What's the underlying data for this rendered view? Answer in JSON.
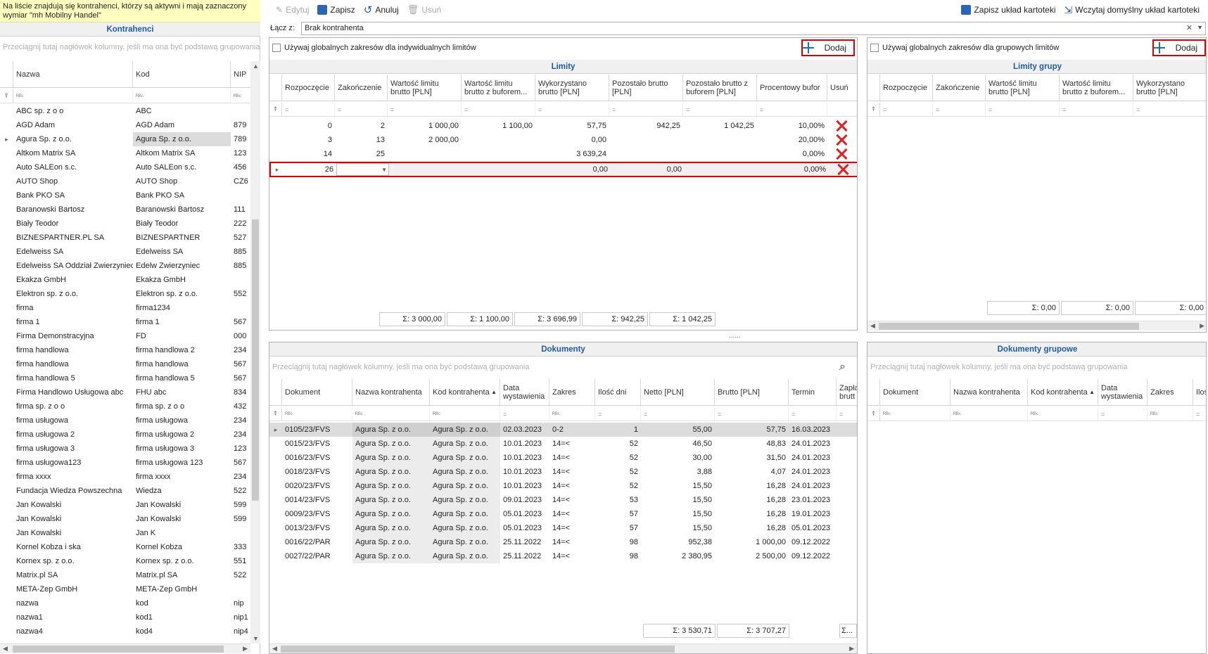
{
  "info_text": "Na liście znajdują się kontrahenci, którzy są aktywni i mają zaznaczony wymiar \"mh Mobilny Handel\"",
  "left": {
    "title": "Kontrahenci",
    "group_hint": "Przeciągnij tutaj nagłówek kolumny, jeśli ma ona być podstawą grupowania",
    "columns": [
      "Nazwa",
      "Kod",
      "NIP"
    ],
    "filter_glyph": "ᴿᴮᶜ",
    "rows": [
      [
        "ABC sp. z o o",
        "ABC",
        ""
      ],
      [
        "AGD Adam",
        "AGD Adam",
        "879"
      ],
      [
        "Agura Sp. z o.o.",
        "Agura Sp. z o.o.",
        "789"
      ],
      [
        "Altkom Matrix SA",
        "Altkom Matrix SA",
        "123"
      ],
      [
        "Auto SALEon s.c.",
        "Auto SALEon s.c.",
        "456"
      ],
      [
        "AUTO Shop",
        "AUTO Shop",
        "CZ6"
      ],
      [
        "Bank PKO SA",
        "Bank PKO SA",
        ""
      ],
      [
        "Baranowski Bartosz",
        "Baranowski Bartosz",
        "111"
      ],
      [
        "Biały Teodor",
        "Biały Teodor",
        "222"
      ],
      [
        "BIZNESPARTNER.PL SA",
        "BIZNESPARTNER",
        "527"
      ],
      [
        "Edelweiss SA",
        "Edelweiss SA",
        "885"
      ],
      [
        "Edelweiss SA Oddział Zwierzyniec",
        "Edelw Zwierzyniec",
        "885"
      ],
      [
        "Ekakza GmbH",
        "Ekakza GmbH",
        ""
      ],
      [
        "Elektron sp. z o.o.",
        "Elektron sp. z o.o.",
        "552"
      ],
      [
        "firma",
        "firma1234",
        ""
      ],
      [
        "firma 1",
        "firma 1",
        "567"
      ],
      [
        "Firma Demonstracyjna",
        "FD",
        "000"
      ],
      [
        "firma handlowa",
        "firma handlowa 2",
        "234"
      ],
      [
        "firma handlowa",
        "firma handlowa",
        "567"
      ],
      [
        "firma handlowa 5",
        "firma handlowa 5",
        "567"
      ],
      [
        "Firma Handlowo Usługowa abc",
        "FHU abc",
        "834"
      ],
      [
        "firma sp. z o o",
        "firma sp. z o o",
        "432"
      ],
      [
        "firma usługowa",
        "firma usługowa",
        "234"
      ],
      [
        "firma usługowa 2",
        "firma usługowa 2",
        "234"
      ],
      [
        "firma usługowa 3",
        "firma usługowa 3",
        "123"
      ],
      [
        "firma usługowa123",
        "firma usługowa 123",
        "567"
      ],
      [
        "firma xxxx",
        "firma xxxx",
        "234"
      ],
      [
        "Fundacja Wiedza Powszechna",
        "Wiedza",
        "522"
      ],
      [
        "Jan Kowalski",
        "Jan Kowalski",
        "599"
      ],
      [
        "Jan Kowalski",
        "Jan Kowalski",
        "599"
      ],
      [
        "Jan Kowalski",
        "Jan K",
        ""
      ],
      [
        "Kornel Kobza i ska",
        "Kornel Kobza",
        "333"
      ],
      [
        "Kornex sp. z o.o.",
        "Kornex sp. z o.o.",
        "551"
      ],
      [
        "Matrix.pl SA",
        "Matrix.pl SA",
        "522"
      ],
      [
        "META-Zep GmbH",
        "META-Zep GmbH",
        ""
      ],
      [
        "nazwa",
        "kod",
        "nip"
      ],
      [
        "nazwa1",
        "kod1",
        "nip1"
      ],
      [
        "nazwa4",
        "kod4",
        "nip4"
      ]
    ]
  },
  "toolbar": {
    "edit": "Edytuj",
    "save": "Zapisz",
    "cancel": "Anuluj",
    "delete": "Usuń",
    "save_layout": "Zapisz układ kartoteki",
    "load_layout": "Wczytaj domyślny układ kartoteki"
  },
  "connect": {
    "label": "Łącz z:",
    "value": "Brak kontrahenta"
  },
  "limits": {
    "checkbox": "Używaj globalnych zakresów dla indywidualnych limitów",
    "add": "Dodaj",
    "title": "Limity",
    "columns": [
      "Rozpoczęcie",
      "Zakończenie",
      "Wartość limitu brutto [PLN]",
      "Wartość limitu brutto z buforem...",
      "Wykorzystano brutto [PLN]",
      "Pozostało brutto [PLN]",
      "Pozostało brutto z buforem [PLN]",
      "Procentowy bufor",
      "Usuń"
    ],
    "filter_glyph": "=",
    "rows": [
      [
        "0",
        "2",
        "1 000,00",
        "1 100,00",
        "57,75",
        "942,25",
        "1 042,25",
        "10,00%"
      ],
      [
        "3",
        "13",
        "2 000,00",
        "",
        "0,00",
        "",
        "",
        "20,00%"
      ],
      [
        "14",
        "25",
        "",
        "",
        "3 639,24",
        "",
        "",
        "0,00%"
      ],
      [
        "26",
        "",
        "",
        "",
        "0,00",
        "0,00",
        "",
        "0,00%"
      ]
    ],
    "sums": [
      "Σ: 3 000,00",
      "Σ: 1 100,00",
      "Σ: 3 696,99",
      "Σ: 942,25",
      "Σ: 1 042,25"
    ]
  },
  "group_limits": {
    "checkbox": "Używaj globalnych zakresów dla grupowych limitów",
    "add": "Dodaj",
    "title": "Limity grupy",
    "columns": [
      "Rozpoczęcie",
      "Zakończenie",
      "Wartość limitu brutto [PLN]",
      "Wartość limitu brutto z buforem...",
      "Wykorzystano brutto [PLN]"
    ],
    "sums": [
      "Σ: 0,00",
      "Σ: 0,00",
      "Σ: 0,00"
    ]
  },
  "splitter": "......",
  "documents": {
    "title": "Dokumenty",
    "group_hint": "Przeciągnij tutaj nagłówek kolumny, jeśli ma ona być podstawą grupowania",
    "columns": [
      "Dokument",
      "Nazwa kontrahenta",
      "Kod kontrahenta",
      "Data wystawienia",
      "Zakres",
      "Ilość dni",
      "Netto [PLN]",
      "Brutto [PLN]",
      "Termin",
      "Zapła brutt"
    ],
    "rows": [
      [
        "0105/23/FVS",
        "Agura Sp. z o.o.",
        "Agura Sp. z o.o.",
        "02.03.2023",
        "0-2",
        "1",
        "55,00",
        "57,75",
        "16.03.2023"
      ],
      [
        "0015/23/FVS",
        "Agura Sp. z o.o.",
        "Agura Sp. z o.o.",
        "10.01.2023",
        "14=<",
        "52",
        "46,50",
        "48,83",
        "24.01.2023"
      ],
      [
        "0016/23/FVS",
        "Agura Sp. z o.o.",
        "Agura Sp. z o.o.",
        "10.01.2023",
        "14=<",
        "52",
        "30,00",
        "31,50",
        "24.01.2023"
      ],
      [
        "0018/23/FVS",
        "Agura Sp. z o.o.",
        "Agura Sp. z o.o.",
        "10.01.2023",
        "14=<",
        "52",
        "3,88",
        "4,07",
        "24.01.2023"
      ],
      [
        "0020/23/FVS",
        "Agura Sp. z o.o.",
        "Agura Sp. z o.o.",
        "10.01.2023",
        "14=<",
        "52",
        "15,50",
        "16,28",
        "24.01.2023"
      ],
      [
        "0014/23/FVS",
        "Agura Sp. z o.o.",
        "Agura Sp. z o.o.",
        "09.01.2023",
        "14=<",
        "53",
        "15,50",
        "16,28",
        "23.01.2023"
      ],
      [
        "0009/23/FVS",
        "Agura Sp. z o.o.",
        "Agura Sp. z o.o.",
        "05.01.2023",
        "14=<",
        "57",
        "15,50",
        "16,28",
        "19.01.2023"
      ],
      [
        "0013/23/FVS",
        "Agura Sp. z o.o.",
        "Agura Sp. z o.o.",
        "05.01.2023",
        "14=<",
        "57",
        "15,50",
        "16,28",
        "05.01.2023"
      ],
      [
        "0016/22/PAR",
        "Agura Sp. z o.o.",
        "Agura Sp. z o.o.",
        "25.11.2022",
        "14=<",
        "98",
        "952,38",
        "1 000,00",
        "09.12.2022"
      ],
      [
        "0027/22/PAR",
        "Agura Sp. z o.o.",
        "Agura Sp. z o.o.",
        "25.11.2022",
        "14=<",
        "98",
        "2 380,95",
        "2 500,00",
        "09.12.2022"
      ]
    ],
    "sums": [
      "Σ: 3 530,71",
      "Σ: 3 707,27",
      "Σ..."
    ]
  },
  "group_documents": {
    "title": "Dokumenty grupowe",
    "group_hint": "Przeciągnij tutaj nagłówek kolumny, jeśli ma ona być podstawą grupowania",
    "columns": [
      "Dokument",
      "Nazwa kontrahenta",
      "Kod kontrahenta",
      "Data wystawienia",
      "Zakres",
      "Iloś"
    ]
  },
  "colors": {
    "accent": "#1e5aa8",
    "highlight": "#e00000",
    "selection": "#dcdcdc",
    "info_bg": "#ffffc0"
  }
}
